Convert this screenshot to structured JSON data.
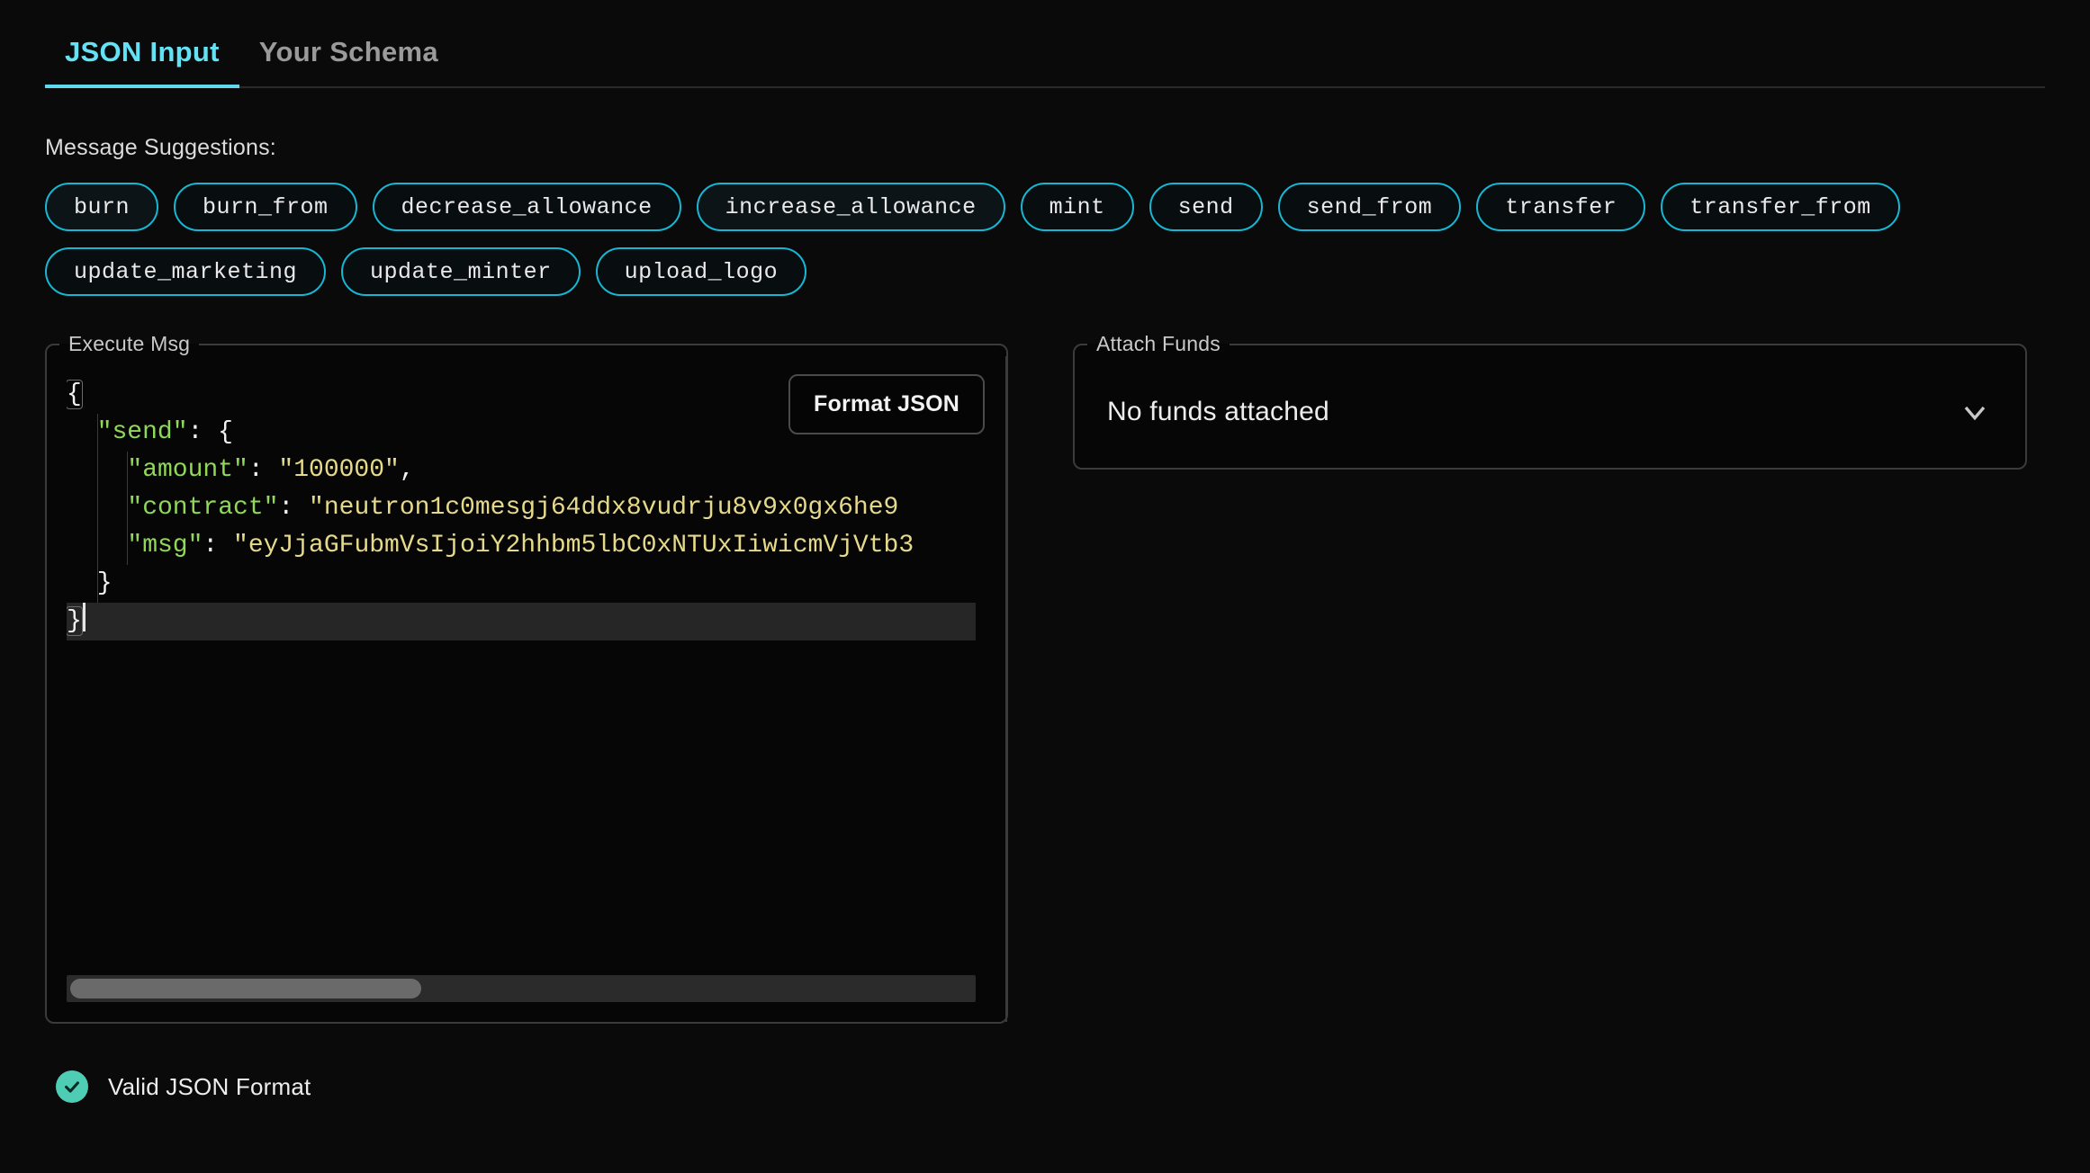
{
  "tabs": [
    {
      "label": "JSON Input",
      "active": true
    },
    {
      "label": "Your Schema",
      "active": false
    }
  ],
  "suggestions": {
    "label": "Message Suggestions:",
    "items": [
      "burn",
      "burn_from",
      "decrease_allowance",
      "increase_allowance",
      "mint",
      "send",
      "send_from",
      "transfer",
      "transfer_from",
      "update_marketing",
      "update_minter",
      "upload_logo"
    ]
  },
  "editor": {
    "legend": "Execute Msg",
    "format_button": "Format JSON",
    "lines": [
      {
        "indent": 0,
        "tokens": [
          {
            "t": "{",
            "c": "punc"
          }
        ]
      },
      {
        "indent": 1,
        "tokens": [
          {
            "t": "\"send\"",
            "c": "key"
          },
          {
            "t": ": {",
            "c": "punc"
          }
        ]
      },
      {
        "indent": 2,
        "tokens": [
          {
            "t": "\"amount\"",
            "c": "key"
          },
          {
            "t": ": ",
            "c": "punc"
          },
          {
            "t": "\"100000\"",
            "c": "str"
          },
          {
            "t": ",",
            "c": "punc"
          }
        ]
      },
      {
        "indent": 2,
        "tokens": [
          {
            "t": "\"contract\"",
            "c": "key"
          },
          {
            "t": ": ",
            "c": "punc"
          },
          {
            "t": "\"neutron1c0mesgj64ddx8vudrju8v9x0gx6he9",
            "c": "str"
          }
        ]
      },
      {
        "indent": 2,
        "tokens": [
          {
            "t": "\"msg\"",
            "c": "key"
          },
          {
            "t": ": ",
            "c": "punc"
          },
          {
            "t": "\"eyJjaGFubmVsIjoiY2hhbm5lbC0xNTUxIiwicmVjVtb3",
            "c": "str"
          }
        ]
      },
      {
        "indent": 1,
        "tokens": [
          {
            "t": "}",
            "c": "punc"
          }
        ]
      },
      {
        "indent": 0,
        "tokens": [
          {
            "t": "}",
            "c": "punc"
          }
        ],
        "active": true,
        "caret": true
      }
    ],
    "scrollbar": {
      "thumb_width_pct": 39
    }
  },
  "funds": {
    "legend": "Attach Funds",
    "selected": "No funds attached",
    "chevron_icon": "chevron-down-icon"
  },
  "status": {
    "icon": "check-circle-icon",
    "text": "Valid JSON Format",
    "color": "#4ecdb4"
  },
  "theme": {
    "background": "#0a0a0a",
    "accent": "#5fd8ef",
    "chip_border": "#17b7d4",
    "key_color": "#8fd858",
    "string_color": "#e6da8a"
  }
}
